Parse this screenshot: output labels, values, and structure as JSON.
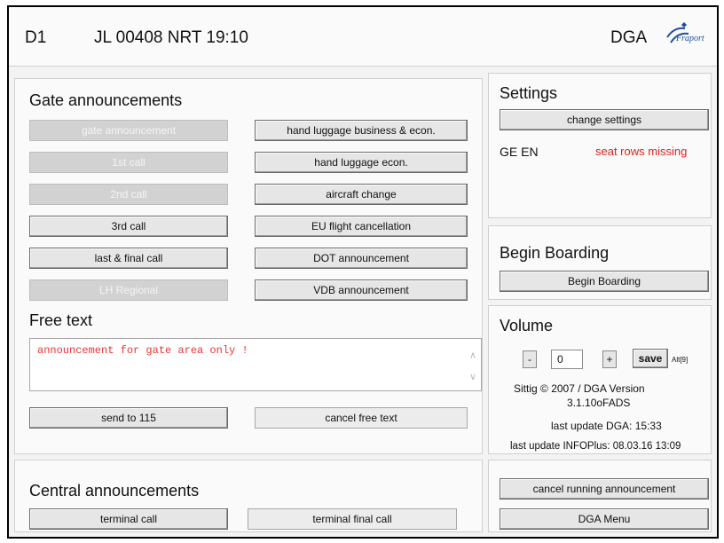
{
  "header": {
    "gate": "D1",
    "flight": "JL 00408 NRT 19:10",
    "app": "DGA",
    "logo_text": "Fraport"
  },
  "gate_announcements": {
    "title": "Gate announcements",
    "left_buttons": [
      "gate announcement",
      "1st call",
      "2nd call",
      "3rd call",
      "last & final call",
      "LH Regional"
    ],
    "right_buttons": [
      "hand luggage business & econ.",
      "hand luggage econ.",
      "aircraft change",
      "EU flight cancellation",
      "DOT announcement",
      "VDB announcement"
    ]
  },
  "free_text": {
    "title": "Free text",
    "value": "announcement for gate area only !",
    "send_label": "send to 115",
    "cancel_label": "cancel free text"
  },
  "settings": {
    "title": "Settings",
    "change_label": "change settings",
    "languages": "GE EN",
    "warning": "seat rows missing",
    "warning_color": "#e02020"
  },
  "boarding": {
    "title": "Begin Boarding",
    "button_label": "Begin Boarding"
  },
  "volume": {
    "title": "Volume",
    "minus": "-",
    "value": "0",
    "plus": "+",
    "save_label": "save",
    "shortcut": "Alt[9]",
    "copyright_line1": "Sittig © 2007 / DGA Version",
    "copyright_line2": "3.1.10oFADS",
    "last_update_dga": "last update DGA:  15:33",
    "last_update_infoplus": "last update INFOPlus:  08.03.16 13:09"
  },
  "central": {
    "title": "Central announcements",
    "terminal_call": "terminal call",
    "terminal_final_call": "terminal final call"
  },
  "footer": {
    "cancel_running": "cancel running announcement",
    "dga_menu": "DGA Menu"
  }
}
